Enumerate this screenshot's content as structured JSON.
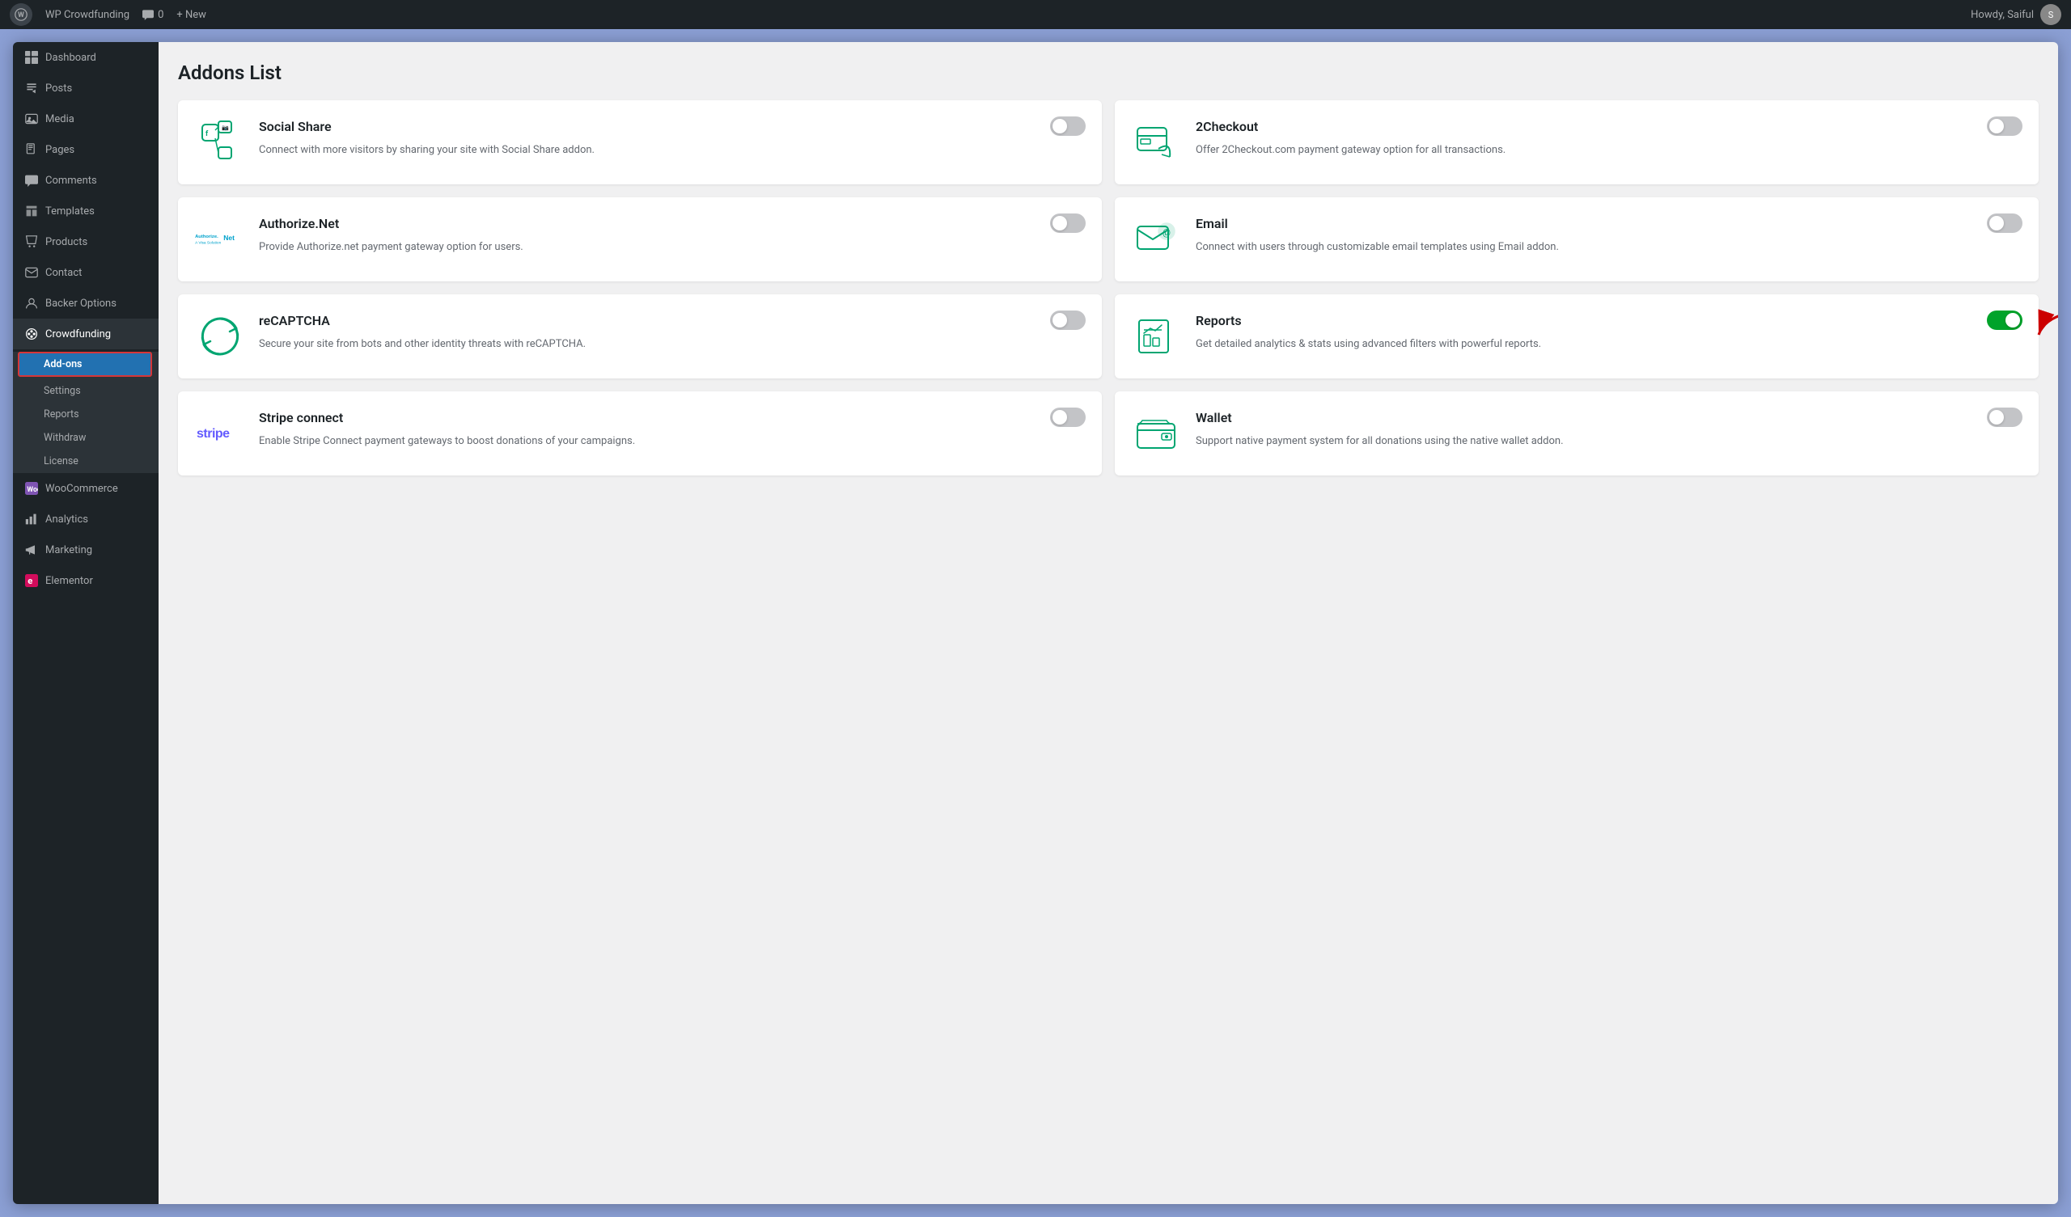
{
  "adminBar": {
    "wpLogo": "W",
    "siteLink": "WP Crowdfunding",
    "comments": "0",
    "newLabel": "+ New",
    "howdy": "Howdy, Saiful"
  },
  "sidebar": {
    "items": [
      {
        "id": "dashboard",
        "label": "Dashboard",
        "icon": "⊞"
      },
      {
        "id": "posts",
        "label": "Posts",
        "icon": "✎"
      },
      {
        "id": "media",
        "label": "Media",
        "icon": "🖼"
      },
      {
        "id": "pages",
        "label": "Pages",
        "icon": "📄"
      },
      {
        "id": "comments",
        "label": "Comments",
        "icon": "💬"
      },
      {
        "id": "templates",
        "label": "Templates",
        "icon": "📁"
      },
      {
        "id": "products",
        "label": "Products",
        "icon": "🛍"
      },
      {
        "id": "contact",
        "label": "Contact",
        "icon": "✉"
      },
      {
        "id": "backer-options",
        "label": "Backer Options",
        "icon": "🎯"
      },
      {
        "id": "crowdfunding",
        "label": "Crowdfunding",
        "icon": "🏘"
      }
    ],
    "submenu": [
      {
        "id": "add-ons",
        "label": "Add-ons",
        "active": true
      },
      {
        "id": "settings",
        "label": "Settings"
      },
      {
        "id": "reports",
        "label": "Reports"
      },
      {
        "id": "withdraw",
        "label": "Withdraw"
      },
      {
        "id": "license",
        "label": "License"
      }
    ],
    "bottomItems": [
      {
        "id": "woocommerce",
        "label": "WooCommerce",
        "icon": "🛒"
      },
      {
        "id": "analytics",
        "label": "Analytics",
        "icon": "📊"
      },
      {
        "id": "marketing",
        "label": "Marketing",
        "icon": "📣"
      },
      {
        "id": "elementor",
        "label": "Elementor",
        "icon": "⚡"
      }
    ]
  },
  "page": {
    "title": "Addons List"
  },
  "addons": [
    {
      "id": "social-share",
      "name": "Social Share",
      "desc": "Connect with more visitors by sharing your site with Social Share addon.",
      "enabled": false
    },
    {
      "id": "2checkout",
      "name": "2Checkout",
      "desc": "Offer 2Checkout.com payment gateway option for all transactions.",
      "enabled": false
    },
    {
      "id": "authorize-net",
      "name": "Authorize.Net",
      "desc": "Provide Authorize.net payment gateway option for users.",
      "enabled": false,
      "logoStyle": "authorize"
    },
    {
      "id": "email",
      "name": "Email",
      "desc": "Connect with users through customizable email templates using Email addon.",
      "enabled": false
    },
    {
      "id": "recaptcha",
      "name": "reCAPTCHA",
      "desc": "Secure your site from bots and other identity threats with reCAPTCHA.",
      "enabled": false
    },
    {
      "id": "reports",
      "name": "Reports",
      "desc": "Get detailed analytics & stats using advanced filters with powerful reports.",
      "enabled": true
    },
    {
      "id": "stripe-connect",
      "name": "Stripe connect",
      "desc": "Enable Stripe Connect payment gateways to boost donations of your campaigns.",
      "enabled": false,
      "logoStyle": "stripe"
    },
    {
      "id": "wallet",
      "name": "Wallet",
      "desc": "Support native payment system for all donations using the native wallet addon.",
      "enabled": false
    }
  ]
}
